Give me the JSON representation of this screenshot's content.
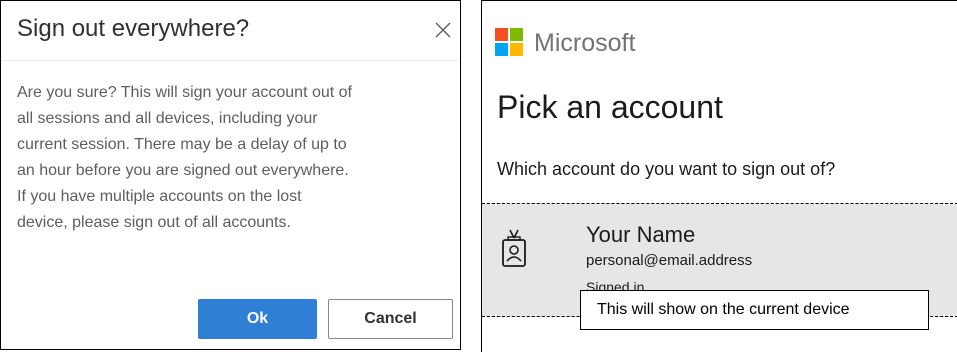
{
  "dialog": {
    "title": "Sign out everywhere?",
    "body_lines": [
      "Are you sure? This will sign your account out of",
      "all sessions and all devices, including your",
      "current session. There may be a delay of up to",
      "an hour before you are signed out everywhere.",
      "If you have multiple accounts on the lost",
      "device, please sign out of all accounts."
    ],
    "ok_label": "Ok",
    "cancel_label": "Cancel",
    "close_icon": "close-icon",
    "colors": {
      "primary": "#2f7fd4",
      "body_text": "#605e5c"
    }
  },
  "panel": {
    "brand": "Microsoft",
    "title": "Pick an account",
    "subtitle": "Which account do you want to sign out of?",
    "account": {
      "name": "Your Name",
      "email": "personal@email.address",
      "status": "Signed in",
      "icon": "badge-icon"
    },
    "callout": "This will show on the current device",
    "logo_colors": [
      "#f25022",
      "#7fba00",
      "#00a4ef",
      "#ffb900"
    ]
  }
}
